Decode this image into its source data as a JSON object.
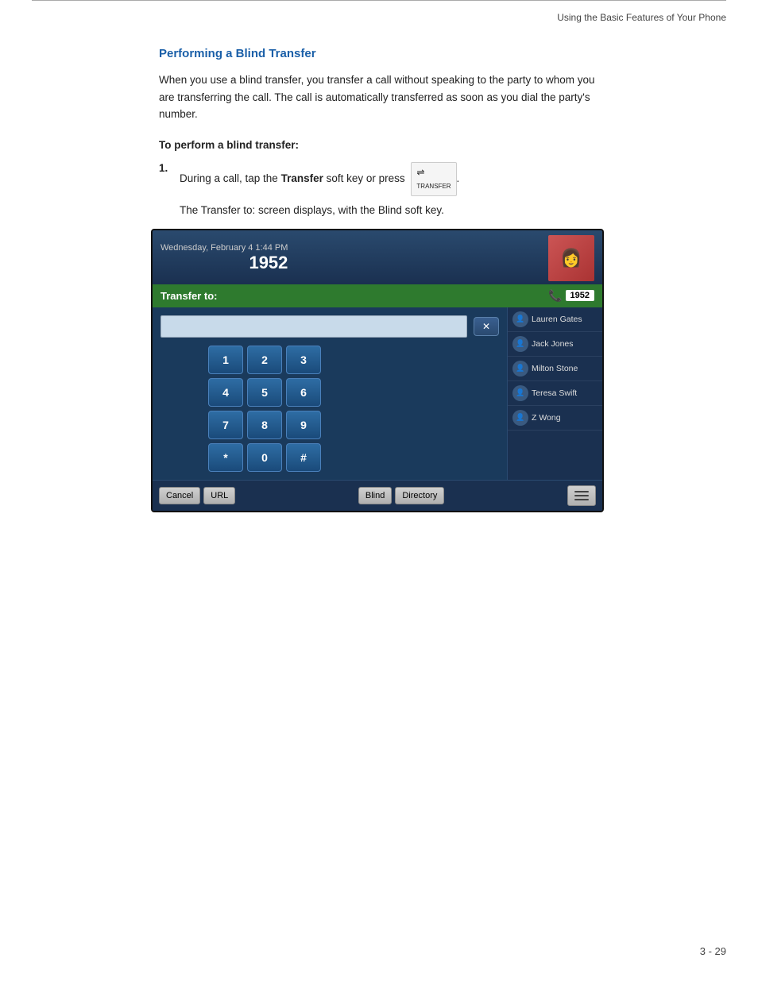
{
  "header": {
    "rule": true,
    "breadcrumb": "Using the Basic Features of Your Phone"
  },
  "section": {
    "title": "Performing a Blind Transfer",
    "body": "When you use a blind transfer, you transfer a call without speaking to the party to whom you are transferring the call. The call is automatically transferred as soon as you dial the party's number.",
    "subheading": "To perform a blind transfer:",
    "step1_prefix": "During a call, tap the ",
    "step1_bold": "Transfer",
    "step1_suffix": " soft key or press",
    "step1_btn_line1": "⇌",
    "step1_btn_line2": "TRANSFER",
    "note": "The Transfer to: screen displays, with the Blind soft key."
  },
  "phone_screen": {
    "datetime": "Wednesday, February 4  1:44 PM",
    "extension": "1952",
    "transfer_label": "Transfer to:",
    "active_call_num": "1952",
    "keypad": [
      "1",
      "2",
      "3",
      "4",
      "5",
      "6",
      "7",
      "8",
      "9",
      "*",
      "0",
      "#"
    ],
    "contacts": [
      {
        "name": "Lauren Gates"
      },
      {
        "name": "Jack Jones"
      },
      {
        "name": "Milton Stone"
      },
      {
        "name": "Teresa Swift"
      },
      {
        "name": "Z Wong"
      }
    ],
    "softkeys": [
      "Cancel",
      "URL",
      "Blind",
      "Directory"
    ]
  },
  "footer": {
    "page": "3 - 29"
  }
}
